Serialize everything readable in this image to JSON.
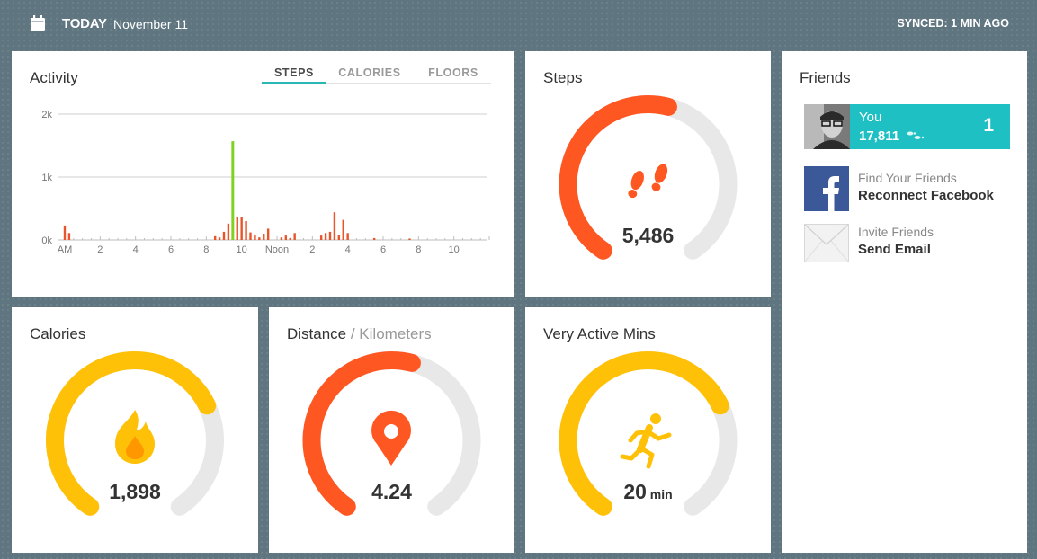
{
  "header": {
    "today_label": "TODAY",
    "date": "November 11",
    "sync_status": "SYNCED: 1 MIN AGO"
  },
  "activity": {
    "title": "Activity",
    "tabs": [
      {
        "label": "STEPS",
        "active": true
      },
      {
        "label": "CALORIES",
        "active": false
      },
      {
        "label": "FLOORS",
        "active": false
      }
    ],
    "chart_data": {
      "type": "bar",
      "title": "Activity",
      "y_tick_labels": [
        "2k",
        "1k",
        "0k"
      ],
      "y_tick_values": [
        2000,
        1000,
        0
      ],
      "ylim": [
        0,
        2000
      ],
      "x_tick_labels": [
        "AM",
        "2",
        "4",
        "6",
        "8",
        "10",
        "Noon",
        "2",
        "4",
        "6",
        "8",
        "10"
      ],
      "x_tick_hours": [
        0,
        2,
        4,
        6,
        8,
        10,
        12,
        14,
        16,
        18,
        20,
        22
      ],
      "xlim": [
        0,
        24
      ],
      "grid": true,
      "colors": {
        "normal": "#e8552b",
        "peak": "#7ed321"
      },
      "series": [
        {
          "x": [
            0.0,
            0.25,
            8.5,
            8.75,
            9.0,
            9.25,
            9.5,
            9.75,
            10.0,
            10.25,
            10.5,
            10.75,
            11.0,
            11.25,
            11.5,
            12.25,
            12.5,
            12.75,
            13.0,
            14.5,
            14.75,
            15.0,
            15.25,
            15.5,
            15.75,
            16.0,
            17.5,
            19.5
          ],
          "values": [
            230,
            110,
            60,
            40,
            130,
            260,
            1570,
            370,
            360,
            300,
            120,
            80,
            40,
            100,
            180,
            40,
            70,
            30,
            110,
            70,
            110,
            130,
            440,
            80,
            320,
            110,
            30,
            20
          ]
        }
      ]
    }
  },
  "steps": {
    "title": "Steps",
    "value": "5,486",
    "progress": 0.55,
    "color": "#ff5722",
    "icon": "footsteps-icon"
  },
  "calories": {
    "title": "Calories",
    "value": "1,898",
    "progress": 0.72,
    "color": "#ffc107",
    "icon": "flame-icon"
  },
  "distance": {
    "title": "Distance",
    "subtitle": " / Kilometers",
    "value": "4.24",
    "progress": 0.55,
    "color": "#ff5722",
    "icon": "location-pin-icon"
  },
  "active_mins": {
    "title": "Very Active Mins",
    "value": "20",
    "unit": " min",
    "progress": 0.72,
    "color": "#ffc107",
    "icon": "runner-icon"
  },
  "friends": {
    "title": "Friends",
    "you": {
      "name": "You",
      "steps": "17,811",
      "rank": "1"
    },
    "facebook": {
      "small": "Find Your Friends",
      "big": "Reconnect Facebook"
    },
    "email": {
      "small": "Invite Friends",
      "big": "Send Email"
    }
  },
  "colors": {
    "accent": "#1ec0c3",
    "gauge_track": "#e8e8e8"
  }
}
